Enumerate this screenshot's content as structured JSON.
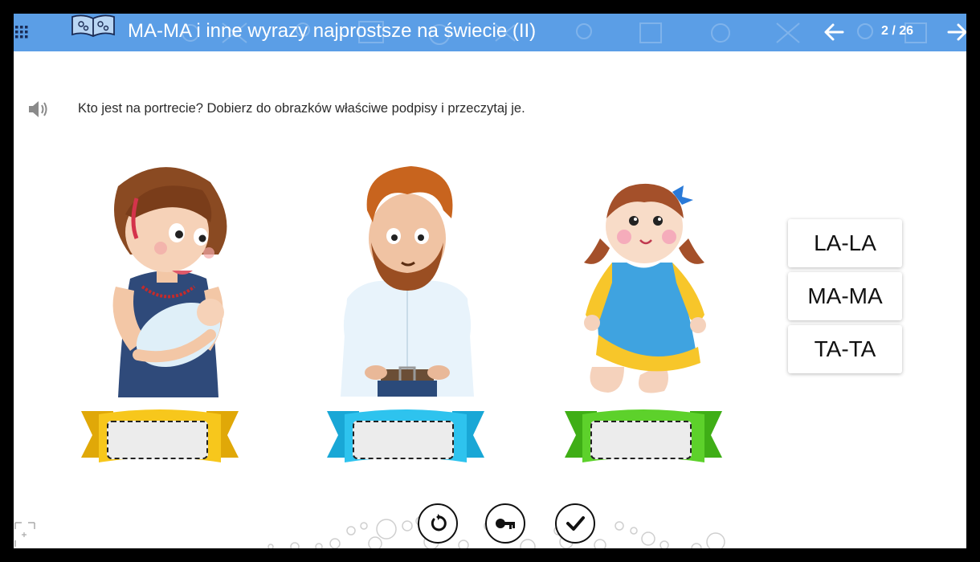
{
  "header": {
    "title": "MA-MA i inne wyrazy najprostsze na świecie (II)",
    "counter": "2 / 26",
    "color": "#5b9ee6",
    "icons": [
      "menu-icon",
      "book-icon",
      "arrow-left-icon",
      "arrow-right-icon"
    ]
  },
  "instruction": {
    "text": "Kto jest na portrecie? Dobierz do obrazków właściwe podpisy i przeczytaj je.",
    "icon": "speaker-icon"
  },
  "pictures": [
    {
      "name": "mother-with-baby",
      "ribbon_color": "#f4c21c",
      "slot_value": ""
    },
    {
      "name": "father",
      "ribbon_color": "#2ec3ee",
      "slot_value": ""
    },
    {
      "name": "doll",
      "ribbon_color": "#5dd12b",
      "slot_value": ""
    }
  ],
  "words": [
    "LA-LA",
    "MA-MA",
    "TA-TA"
  ],
  "controls": {
    "icons": [
      "reset-icon",
      "key-icon",
      "check-icon"
    ]
  }
}
